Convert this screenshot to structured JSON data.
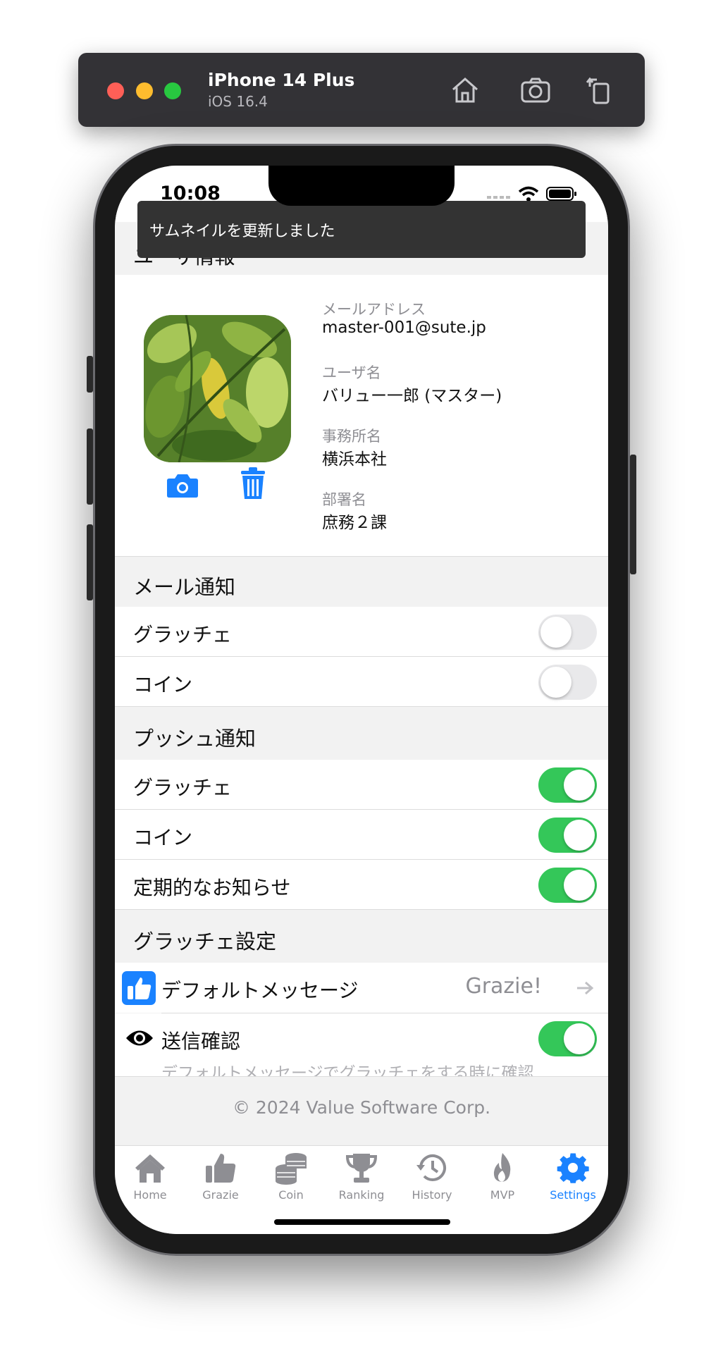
{
  "simulator": {
    "device_name": "iPhone 14 Plus",
    "os_version": "iOS 16.4"
  },
  "status_bar": {
    "time": "10:08"
  },
  "toast": {
    "message": "サムネイルを更新しました"
  },
  "user_info": {
    "section_title": "ユーザ情報",
    "fields": [
      {
        "label": "メールアドレス",
        "value": "master-001@sute.jp"
      },
      {
        "label": "ユーザ名",
        "value": "バリュー一郎 (マスター)"
      },
      {
        "label": "事務所名",
        "value": "横浜本社"
      },
      {
        "label": "部署名",
        "value": "庶務２課"
      }
    ]
  },
  "mail_notification": {
    "section_title": "メール通知",
    "rows": [
      {
        "label": "グラッチェ",
        "enabled": false
      },
      {
        "label": "コイン",
        "enabled": false
      }
    ]
  },
  "push_notification": {
    "section_title": "プッシュ通知",
    "rows": [
      {
        "label": "グラッチェ",
        "enabled": true
      },
      {
        "label": "コイン",
        "enabled": true
      },
      {
        "label": "定期的なお知らせ",
        "enabled": true
      }
    ]
  },
  "grazie_settings": {
    "section_title": "グラッチェ設定",
    "default_message": {
      "label": "デフォルトメッセージ",
      "value": "Grazie!"
    },
    "send_confirm": {
      "label": "送信確認",
      "enabled": true
    },
    "note": "デフォルトメッセージでグラッチェをする時に確認"
  },
  "footer": {
    "copyright": "© 2024 Value Software Corp."
  },
  "tab_bar": {
    "tabs": [
      {
        "label": "Home",
        "icon": "house-icon",
        "active": false
      },
      {
        "label": "Grazie",
        "icon": "thumbs-up-icon",
        "active": false
      },
      {
        "label": "Coin",
        "icon": "coins-icon",
        "active": false
      },
      {
        "label": "Ranking",
        "icon": "trophy-icon",
        "active": false
      },
      {
        "label": "History",
        "icon": "history-icon",
        "active": false
      },
      {
        "label": "MVP",
        "icon": "flame-icon",
        "active": false
      },
      {
        "label": "Settings",
        "icon": "gear-icon",
        "active": true
      }
    ]
  },
  "colors": {
    "accent": "#1a82ff",
    "toggle_on": "#34c759",
    "toggle_off": "#e9e9eb"
  }
}
